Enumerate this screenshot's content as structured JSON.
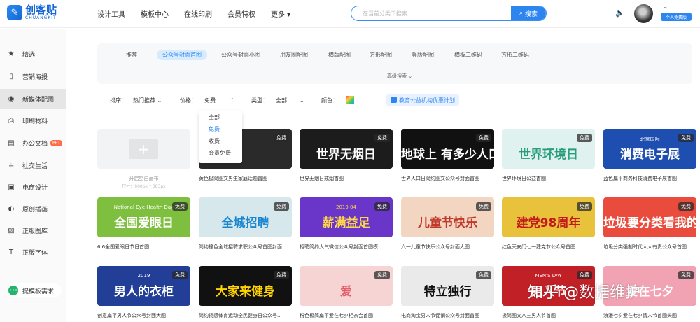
{
  "header": {
    "logo_cn": "创客贴",
    "logo_en": "CHUANGKIT",
    "nav": [
      "设计工具",
      "模板中心",
      "在线印刷",
      "会员特权",
      "更多 ▾"
    ],
    "search_placeholder": "在当前分类下搜索",
    "search_button": "搜索",
    "user_name": "_H",
    "user_badge": "个人免费版"
  },
  "sidebar": {
    "items": [
      {
        "label": "精选",
        "icon": "★"
      },
      {
        "label": "营销海报",
        "icon": "▯"
      },
      {
        "label": "新媒体配图",
        "icon": "◉"
      },
      {
        "label": "印刷物料",
        "icon": "⎙"
      },
      {
        "label": "办公文档",
        "icon": "▤"
      },
      {
        "label": "社交生活",
        "icon": "☕"
      },
      {
        "label": "电商设计",
        "icon": "▣"
      },
      {
        "label": "原创插画",
        "icon": "◐"
      },
      {
        "label": "正版图库",
        "icon": "▨"
      },
      {
        "label": "正版字体",
        "icon": "T"
      }
    ],
    "ppt_badge": "PPT",
    "request": "提模板需求"
  },
  "categories": {
    "tabs": [
      "推荐",
      "公众号封面首图",
      "公众号封面小图",
      "朋友圈配图",
      "横版配图",
      "方形配图",
      "竖版配图",
      "横板二维码",
      "方形二维码"
    ],
    "advanced": "高级搜索 ⌄"
  },
  "filters": {
    "sort_label": "排序：",
    "sort_value": "热门推荐",
    "price_label": "价格：",
    "price_value": "免费",
    "type_label": "类型：",
    "type_value": "全部",
    "color_label": "颜色：",
    "plan": "教育公益机构优惠计划",
    "price_options": [
      "全部",
      "免费",
      "收费",
      "会员免费"
    ]
  },
  "blank_card": {
    "title": "开启空白画布",
    "size": "尺寸：900px * 383px"
  },
  "free_label": "免费",
  "templates": [
    {
      "caption": "黄色极简图文男生家庭话题首图",
      "text": "",
      "sub": "",
      "bg": "#2a2a2a",
      "fg": "#f5b62c"
    },
    {
      "caption": "世界无烟日戒烟首图",
      "text": "世界无烟日",
      "sub": "",
      "bg": "#1c1c1c",
      "fg": "#ffffff"
    },
    {
      "caption": "世界人口日简约图文公众号封面首图",
      "text": "地球上   有多少人口？",
      "sub": "",
      "bg": "#111111",
      "fg": "#ffffff"
    },
    {
      "caption": "世界环境日公益首图",
      "text": "世界环境日",
      "sub": "",
      "bg": "#dff2f0",
      "fg": "#2a9e7a"
    },
    {
      "caption": "蓝色扁平商务科技消费电子展首图",
      "text": "消费电子展",
      "sub": "北京国际",
      "bg": "#1e4fb0",
      "fg": "#ffffff"
    },
    {
      "caption": "6.6全国爱眼日节日首图",
      "text": "全国爱眼日",
      "sub": "National Eye Health Day",
      "bg": "#7fbf3f",
      "fg": "#ffffff"
    },
    {
      "caption": "简约撞色全城招聘求职公众号首图封面",
      "text": "全城招聘",
      "sub": "",
      "bg": "#d6e8ec",
      "fg": "#1c86d1"
    },
    {
      "caption": "招聘简约大气微信公众号封面首图模",
      "text": "薪满益足",
      "sub": "2019 04",
      "bg": "#6a35c9",
      "fg": "#ffd64a"
    },
    {
      "caption": "六一儿童节快乐公众号封面大图",
      "text": "儿童节快乐",
      "sub": "",
      "bg": "#f3d6c2",
      "fg": "#c0392b"
    },
    {
      "caption": "红色天安门七一建党节公众号首图",
      "text": "建党98周年",
      "sub": "",
      "bg": "#e8c23a",
      "fg": "#c4161c"
    },
    {
      "caption": "垃圾分类强制时代人人有责公众号首图",
      "text": "垃圾要分类看我的",
      "sub": "",
      "bg": "#e94b3c",
      "fg": "#ffffff"
    },
    {
      "caption": "创意扁平男人节公众号封面大图",
      "text": "男人的衣柜",
      "sub": "2019",
      "bg": "#233e96",
      "fg": "#ffffff"
    },
    {
      "caption": "简约扬感体育运动全民健身日公众号...",
      "text": "大家来健身",
      "sub": "",
      "bg": "#111111",
      "fg": "#ffd400"
    },
    {
      "caption": "粉色极简扁平爱在七夕相亲会首图",
      "text": "爱",
      "sub": "",
      "bg": "#f6d4d4",
      "fg": "#e25c6a"
    },
    {
      "caption": "电商淘宝男人节促销公众号封面首图",
      "text": "特立独行",
      "sub": "",
      "bg": "#eaeaea",
      "fg": "#111111"
    },
    {
      "caption": "极简图文八三男人节首图",
      "text": "男人节",
      "sub": "MEN'S DAY",
      "bg": "#c22027",
      "fg": "#ffffff"
    },
    {
      "caption": "浪漫七夕爱在七夕情人节首图头图",
      "text": "爱在七夕",
      "sub": "",
      "bg": "#f2a3b3",
      "fg": "#ffffff"
    }
  ],
  "watermark": "知乎 @数据维护"
}
